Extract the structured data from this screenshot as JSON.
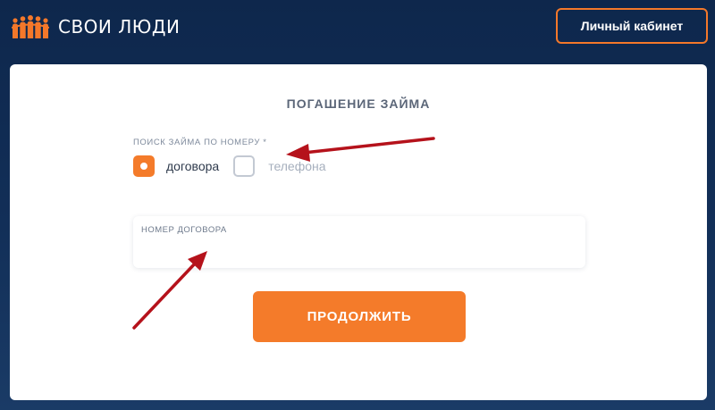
{
  "header": {
    "brand": "СВОИ ЛЮДИ",
    "cabinet_label": "Личный кабинет"
  },
  "form": {
    "title": "ПОГАШЕНИЕ ЗАЙМА",
    "search_label": "ПОИСК ЗАЙМА ПО НОМЕРУ *",
    "options": [
      {
        "label": "договора",
        "selected": true
      },
      {
        "label": "телефона",
        "selected": false
      }
    ],
    "field_label": "НОМЕР ДОГОВОРА",
    "field_value": "",
    "submit_label": "ПРОДОЛЖИТЬ"
  },
  "colors": {
    "background": "#122f58",
    "accent": "#f47b2a",
    "annotation_arrow": "#c0141c"
  },
  "icons": {
    "logo": "people-logo-icon",
    "annotation_arrows": "red-arrow-icon"
  }
}
